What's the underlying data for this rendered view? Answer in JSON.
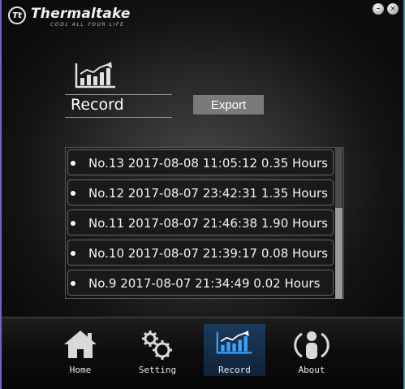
{
  "brand": {
    "name": "Thermaltake",
    "tagline": "COOL ALL YOUR LIFE",
    "logo_mark": "Tt"
  },
  "window": {
    "minimize": "–",
    "close": "×"
  },
  "section": {
    "title": "Record",
    "export_label": "Export",
    "icon": "chart-icon"
  },
  "records": [
    {
      "text": "No.13   2017-08-08 11:05:12    0.35   Hours"
    },
    {
      "text": "No.12   2017-08-07 23:42:31    1.35   Hours"
    },
    {
      "text": "No.11   2017-08-07 21:46:38    1.90   Hours"
    },
    {
      "text": "No.10   2017-08-07 21:39:17    0.08   Hours"
    },
    {
      "text": "No.9   2017-08-07 21:34:49    0.02   Hours"
    }
  ],
  "nav": {
    "home": "Home",
    "setting": "Setting",
    "record": "Record",
    "about": "About",
    "active": "Record"
  },
  "colors": {
    "accent_blue": "#2f8fe0",
    "active_tab_bg": "#16304e",
    "export_bg": "#7a7a7a"
  }
}
